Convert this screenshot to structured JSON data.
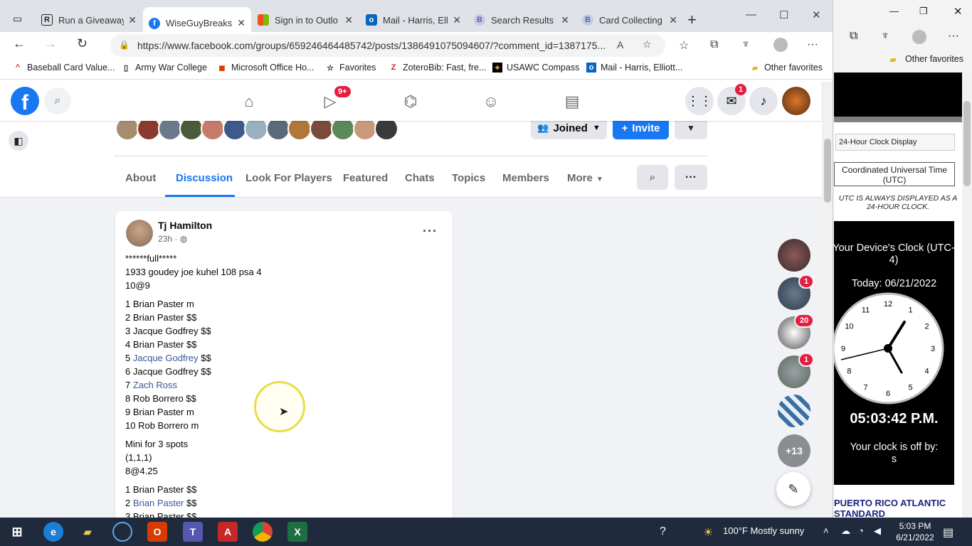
{
  "browser": {
    "tabs": [
      {
        "label": "Run a Giveaway",
        "icon": "R"
      },
      {
        "label": "WiseGuyBreaks",
        "icon": "f"
      },
      {
        "label": "Sign in to Outlo",
        "icon": "ms"
      },
      {
        "label": "Mail - Harris, Ell",
        "icon": "o"
      },
      {
        "label": "Search Results",
        "icon": "B"
      },
      {
        "label": "Card Collecting",
        "icon": "B"
      }
    ],
    "url": "https://www.facebook.com/groups/659246464485742/posts/1386491075094607/?comment_id=1387175...",
    "bookmarks": [
      "Baseball Card Value...",
      "Army War College",
      "Microsoft Office Ho...",
      "Favorites",
      "ZoteroBib: Fast, fre...",
      "USAWC Compass",
      "Mail - Harris, Elliott...",
      "Other favorites"
    ],
    "right_bookmark": "Other favorites"
  },
  "fb": {
    "watch_badge": "9+",
    "messenger_badge": "1",
    "group_buttons": {
      "joined": "Joined",
      "invite": "Invite"
    },
    "tabs": [
      "About",
      "Discussion",
      "Look For Players",
      "Featured",
      "Chats",
      "Topics",
      "Members",
      "More"
    ],
    "post": {
      "author": "Tj Hamilton",
      "time": "23h ·",
      "header_lines": [
        "******full*****",
        "1933 goudey joe kuhel 108 psa 4",
        "10@9"
      ],
      "list1": [
        {
          "num": "1",
          "name": "Brian Paster",
          "suffix": "m",
          "link": false
        },
        {
          "num": "2",
          "name": "Brian Paster",
          "suffix": "$$",
          "link": false
        },
        {
          "num": "3",
          "name": "Jacque Godfrey",
          "suffix": "$$",
          "link": false
        },
        {
          "num": "4",
          "name": "Brian Paster",
          "suffix": "$$",
          "link": false
        },
        {
          "num": "5",
          "name": "Jacque Godfrey",
          "suffix": "$$",
          "link": true
        },
        {
          "num": "6",
          "name": "Jacque Godfrey",
          "suffix": "$$",
          "link": false
        },
        {
          "num": "7",
          "name": "Zach Ross",
          "suffix": "",
          "link": true
        },
        {
          "num": "8",
          "name": "Rob Borrero",
          "suffix": "$$",
          "link": false
        },
        {
          "num": "9",
          "name": "Brian Paster",
          "suffix": "m",
          "link": false
        },
        {
          "num": "10",
          "name": "Rob Borrero",
          "suffix": "m",
          "link": false
        }
      ],
      "mini_lines": [
        "Mini for 3 spots",
        "(1,1,1)",
        "8@4.25"
      ],
      "list2": [
        {
          "num": "1",
          "name": "Brian Paster",
          "suffix": "$$",
          "link": false
        },
        {
          "num": "2",
          "name": "Brian Paster",
          "suffix": "$$",
          "link": true
        },
        {
          "num": "3",
          "name": "Brian Paster",
          "suffix": "$$",
          "link": false
        }
      ]
    },
    "chat_badges": [
      "1",
      "20",
      "1"
    ],
    "chat_more": "+13"
  },
  "clock": {
    "display_button": "24-Hour Clock Display",
    "utc_button": "Coordinated Universal Time (UTC)",
    "utc_note": "UTC IS ALWAYS DISPLAYED AS A 24-HOUR CLOCK.",
    "device_clock": "Your Device's Clock (UTC-4)",
    "today": "Today: 06/21/2022",
    "digital": "05:03:42 P.M.",
    "off_by": "Your clock is off by:",
    "off_by_value": "s",
    "region": "PUERTO RICO ATLANTIC STANDARD",
    "numbers": [
      "12",
      "1",
      "2",
      "3",
      "4",
      "5",
      "6",
      "7",
      "8",
      "9",
      "10",
      "11"
    ]
  },
  "taskbar": {
    "weather": "100°F  Mostly sunny",
    "time": "5:03 PM",
    "date": "6/21/2022"
  }
}
